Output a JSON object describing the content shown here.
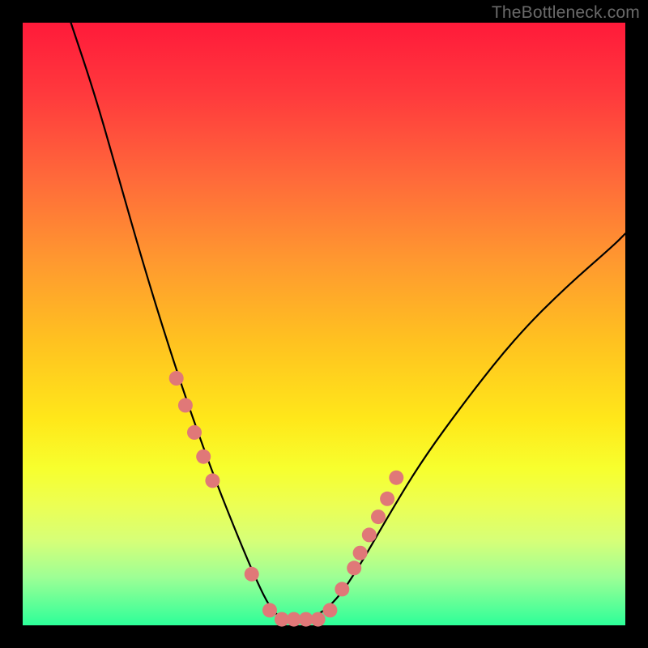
{
  "watermark": "TheBottleneck.com",
  "chart_data": {
    "type": "line",
    "title": "",
    "xlabel": "",
    "ylabel": "",
    "xlim": [
      0,
      100
    ],
    "ylim": [
      0,
      100
    ],
    "series": [
      {
        "name": "curve",
        "x": [
          8,
          12,
          16,
          20,
          24,
          28,
          32,
          36,
          39,
          41,
          43,
          45,
          48,
          52,
          56,
          60,
          66,
          74,
          82,
          90,
          98,
          100
        ],
        "y": [
          100,
          88,
          74,
          60,
          47,
          35,
          24,
          14,
          7,
          3,
          1,
          1,
          1,
          4,
          10,
          17,
          27,
          38,
          48,
          56,
          63,
          65
        ]
      }
    ],
    "markers": {
      "name": "dots",
      "x": [
        25.5,
        27.0,
        28.5,
        30.0,
        31.5,
        38.0,
        41.0,
        43.0,
        45.0,
        47.0,
        49.0,
        51.0,
        53.0,
        55.0,
        56.0,
        57.5,
        59.0,
        60.5,
        62.0
      ],
      "y": [
        41.0,
        36.5,
        32.0,
        28.0,
        24.0,
        8.5,
        2.5,
        1.0,
        1.0,
        1.0,
        1.0,
        2.5,
        6.0,
        9.5,
        12.0,
        15.0,
        18.0,
        21.0,
        24.5
      ]
    },
    "colors": {
      "curve": "#000000",
      "marker": "#e07878"
    }
  }
}
